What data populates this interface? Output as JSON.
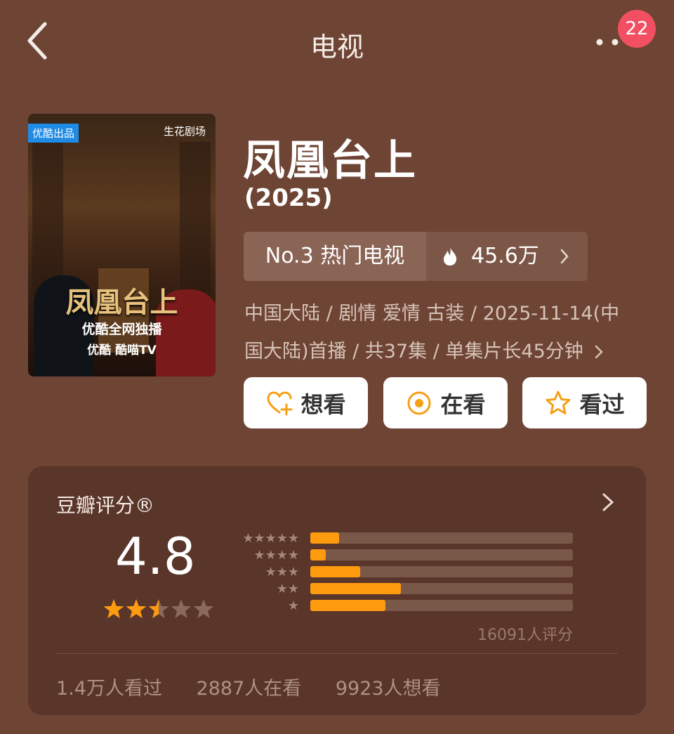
{
  "header": {
    "back_icon": "chevron-left-icon",
    "title": "电视",
    "more_icon": "more-dots-icon",
    "notification_count": "22"
  },
  "poster": {
    "tag": "优酷出品",
    "studio": "生花剧场",
    "title": "凤凰台上",
    "exclusive": "优酷全网独播",
    "platforms": "优酷  酷喵TV"
  },
  "show": {
    "name": "凤凰台上",
    "year": "(2025)",
    "rank_label": "No.3 热门电视",
    "heat_value": "45.6万",
    "meta_line1": "中国大陆 / 剧情 爱情 古装 / 2025-11-14(中",
    "meta_line2": "国大陆)首播 / 共37集 / 单集片长45分钟"
  },
  "actions": {
    "want_label": "想看",
    "watching_label": "在看",
    "watched_label": "看过"
  },
  "rating": {
    "label": "豆瓣评分®",
    "score": "4.8",
    "stars": 2.5,
    "distribution": [
      {
        "stars": 5,
        "fraction": 0.11
      },
      {
        "stars": 4,
        "fraction": 0.06
      },
      {
        "stars": 3,
        "fraction": 0.19
      },
      {
        "stars": 2,
        "fraction": 0.345
      },
      {
        "stars": 1,
        "fraction": 0.285
      }
    ],
    "count_text": "16091人评分",
    "watched_text": "1.4万人看过",
    "watching_text": "2887人在看",
    "want_text": "9923人想看"
  },
  "colors": {
    "background": "#6e4434",
    "card": "#5a3529",
    "accent": "#ff9b0f",
    "badge": "#f25062"
  }
}
